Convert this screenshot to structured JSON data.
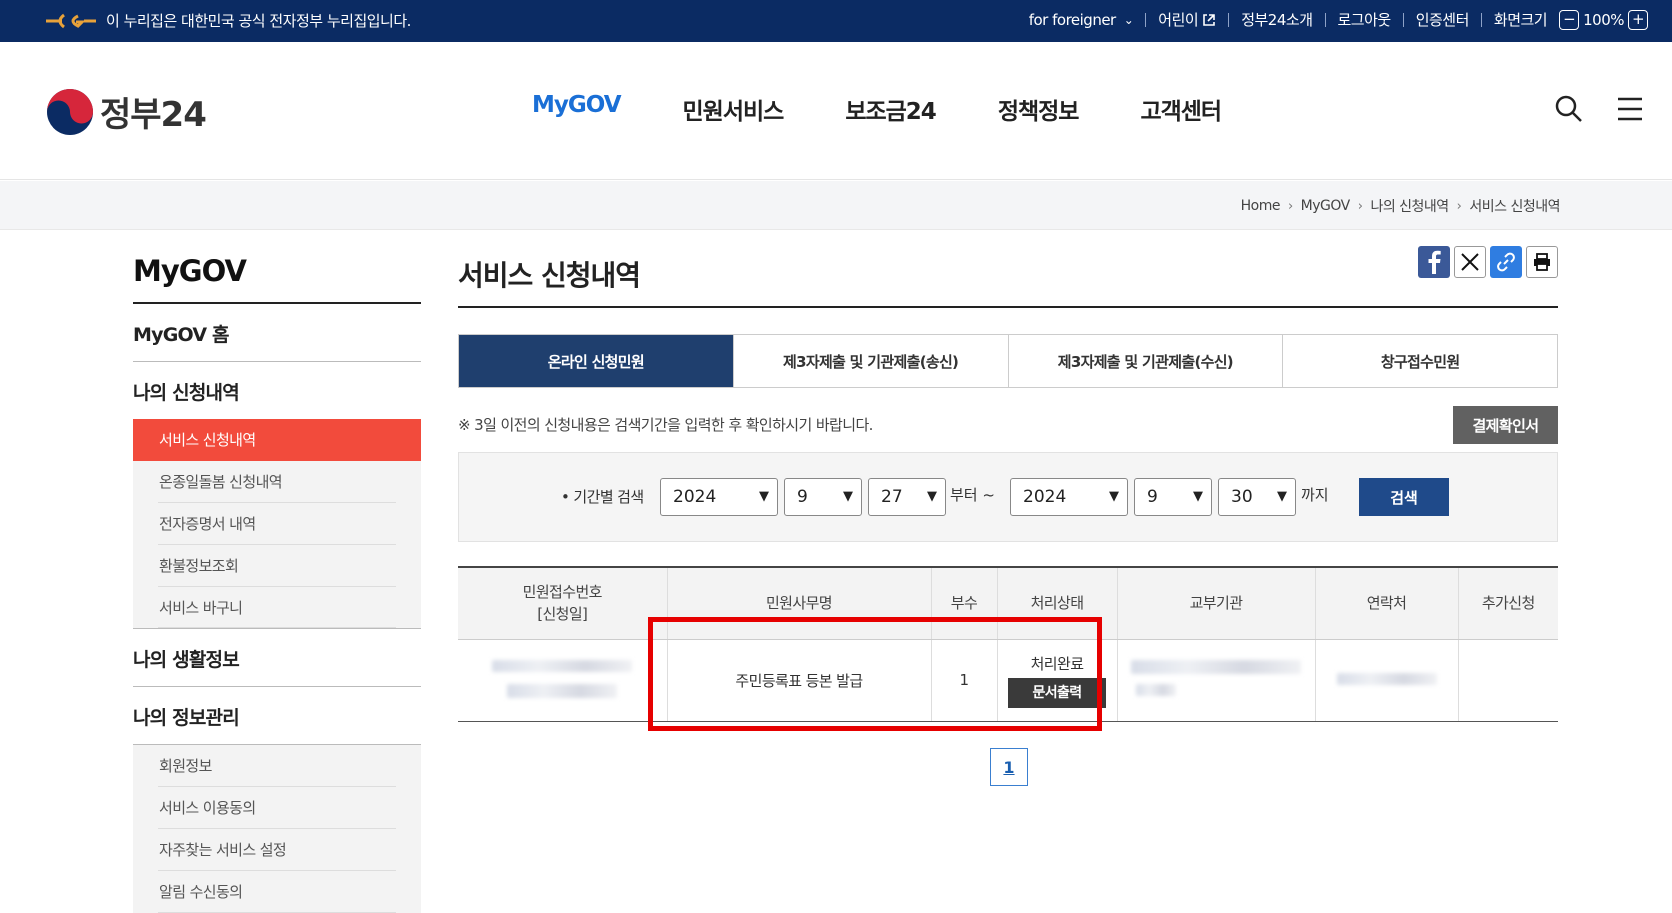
{
  "topbar": {
    "notice": "이 누리집은 대한민국 공식 전자정부 누리집입니다.",
    "foreigner": "for foreigner",
    "kids": "어린이",
    "about": "정부24소개",
    "logout": "로그아웃",
    "cert": "인증센터",
    "screen_size": "화면크기",
    "zoom_minus": "−",
    "zoom_value": "100%",
    "zoom_plus": "+"
  },
  "header": {
    "logo_text": "정부24",
    "menu": [
      "MyGOV",
      "민원서비스",
      "보조금24",
      "정책정보",
      "고객센터"
    ]
  },
  "breadcrumb": [
    "Home",
    "MyGOV",
    "나의 신청내역",
    "서비스 신청내역"
  ],
  "sidebar": {
    "title": "MyGOV",
    "home": "MyGOV 홈",
    "section1": "나의 신청내역",
    "section1_items": [
      "서비스 신청내역",
      "온종일돌봄 신청내역",
      "전자증명서 내역",
      "환불정보조회",
      "서비스 바구니"
    ],
    "section2": "나의 생활정보",
    "section3": "나의 정보관리",
    "section3_items": [
      "회원정보",
      "서비스 이용동의",
      "자주찾는 서비스 설정",
      "알림 수신동의"
    ]
  },
  "main": {
    "title": "서비스 신청내역",
    "tabs": [
      "온라인 신청민원",
      "제3자제출 및 기관제출(송신)",
      "제3자제출 및 기관제출(수신)",
      "창구접수민원"
    ],
    "note": "※ 3일 이전의 신청내용은 검색기간을 입력한 후 확인하시기 바랍니다.",
    "pay_button": "결제확인서",
    "search": {
      "label": "• 기간별 검색",
      "from_year": "2024",
      "from_month": "9",
      "from_day": "27",
      "from_text": "부터 ~",
      "to_year": "2024",
      "to_month": "9",
      "to_day": "30",
      "to_text": "까지",
      "button": "검색"
    },
    "table": {
      "headers": [
        "민원접수번호\n[신청일]",
        "민원사무명",
        "부수",
        "처리상태",
        "교부기관",
        "연락처",
        "추가신청"
      ],
      "row": {
        "name": "주민등록표 등본 발급",
        "copies": "1",
        "status": "처리완료",
        "print_button": "문서출력"
      }
    },
    "page": "1"
  }
}
